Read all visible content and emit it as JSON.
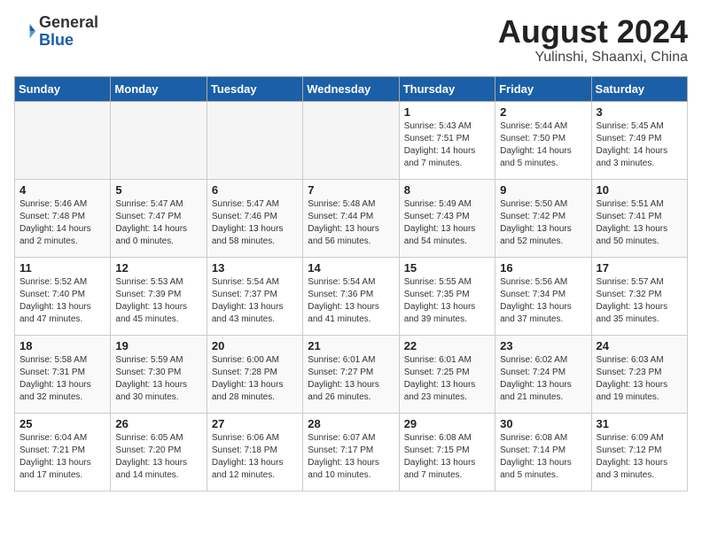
{
  "header": {
    "logo_general": "General",
    "logo_blue": "Blue",
    "month_year": "August 2024",
    "location": "Yulinshi, Shaanxi, China"
  },
  "weekdays": [
    "Sunday",
    "Monday",
    "Tuesday",
    "Wednesday",
    "Thursday",
    "Friday",
    "Saturday"
  ],
  "weeks": [
    [
      {
        "day": "",
        "info": ""
      },
      {
        "day": "",
        "info": ""
      },
      {
        "day": "",
        "info": ""
      },
      {
        "day": "",
        "info": ""
      },
      {
        "day": "1",
        "info": "Sunrise: 5:43 AM\nSunset: 7:51 PM\nDaylight: 14 hours\nand 7 minutes."
      },
      {
        "day": "2",
        "info": "Sunrise: 5:44 AM\nSunset: 7:50 PM\nDaylight: 14 hours\nand 5 minutes."
      },
      {
        "day": "3",
        "info": "Sunrise: 5:45 AM\nSunset: 7:49 PM\nDaylight: 14 hours\nand 3 minutes."
      }
    ],
    [
      {
        "day": "4",
        "info": "Sunrise: 5:46 AM\nSunset: 7:48 PM\nDaylight: 14 hours\nand 2 minutes."
      },
      {
        "day": "5",
        "info": "Sunrise: 5:47 AM\nSunset: 7:47 PM\nDaylight: 14 hours\nand 0 minutes."
      },
      {
        "day": "6",
        "info": "Sunrise: 5:47 AM\nSunset: 7:46 PM\nDaylight: 13 hours\nand 58 minutes."
      },
      {
        "day": "7",
        "info": "Sunrise: 5:48 AM\nSunset: 7:44 PM\nDaylight: 13 hours\nand 56 minutes."
      },
      {
        "day": "8",
        "info": "Sunrise: 5:49 AM\nSunset: 7:43 PM\nDaylight: 13 hours\nand 54 minutes."
      },
      {
        "day": "9",
        "info": "Sunrise: 5:50 AM\nSunset: 7:42 PM\nDaylight: 13 hours\nand 52 minutes."
      },
      {
        "day": "10",
        "info": "Sunrise: 5:51 AM\nSunset: 7:41 PM\nDaylight: 13 hours\nand 50 minutes."
      }
    ],
    [
      {
        "day": "11",
        "info": "Sunrise: 5:52 AM\nSunset: 7:40 PM\nDaylight: 13 hours\nand 47 minutes."
      },
      {
        "day": "12",
        "info": "Sunrise: 5:53 AM\nSunset: 7:39 PM\nDaylight: 13 hours\nand 45 minutes."
      },
      {
        "day": "13",
        "info": "Sunrise: 5:54 AM\nSunset: 7:37 PM\nDaylight: 13 hours\nand 43 minutes."
      },
      {
        "day": "14",
        "info": "Sunrise: 5:54 AM\nSunset: 7:36 PM\nDaylight: 13 hours\nand 41 minutes."
      },
      {
        "day": "15",
        "info": "Sunrise: 5:55 AM\nSunset: 7:35 PM\nDaylight: 13 hours\nand 39 minutes."
      },
      {
        "day": "16",
        "info": "Sunrise: 5:56 AM\nSunset: 7:34 PM\nDaylight: 13 hours\nand 37 minutes."
      },
      {
        "day": "17",
        "info": "Sunrise: 5:57 AM\nSunset: 7:32 PM\nDaylight: 13 hours\nand 35 minutes."
      }
    ],
    [
      {
        "day": "18",
        "info": "Sunrise: 5:58 AM\nSunset: 7:31 PM\nDaylight: 13 hours\nand 32 minutes."
      },
      {
        "day": "19",
        "info": "Sunrise: 5:59 AM\nSunset: 7:30 PM\nDaylight: 13 hours\nand 30 minutes."
      },
      {
        "day": "20",
        "info": "Sunrise: 6:00 AM\nSunset: 7:28 PM\nDaylight: 13 hours\nand 28 minutes."
      },
      {
        "day": "21",
        "info": "Sunrise: 6:01 AM\nSunset: 7:27 PM\nDaylight: 13 hours\nand 26 minutes."
      },
      {
        "day": "22",
        "info": "Sunrise: 6:01 AM\nSunset: 7:25 PM\nDaylight: 13 hours\nand 23 minutes."
      },
      {
        "day": "23",
        "info": "Sunrise: 6:02 AM\nSunset: 7:24 PM\nDaylight: 13 hours\nand 21 minutes."
      },
      {
        "day": "24",
        "info": "Sunrise: 6:03 AM\nSunset: 7:23 PM\nDaylight: 13 hours\nand 19 minutes."
      }
    ],
    [
      {
        "day": "25",
        "info": "Sunrise: 6:04 AM\nSunset: 7:21 PM\nDaylight: 13 hours\nand 17 minutes."
      },
      {
        "day": "26",
        "info": "Sunrise: 6:05 AM\nSunset: 7:20 PM\nDaylight: 13 hours\nand 14 minutes."
      },
      {
        "day": "27",
        "info": "Sunrise: 6:06 AM\nSunset: 7:18 PM\nDaylight: 13 hours\nand 12 minutes."
      },
      {
        "day": "28",
        "info": "Sunrise: 6:07 AM\nSunset: 7:17 PM\nDaylight: 13 hours\nand 10 minutes."
      },
      {
        "day": "29",
        "info": "Sunrise: 6:08 AM\nSunset: 7:15 PM\nDaylight: 13 hours\nand 7 minutes."
      },
      {
        "day": "30",
        "info": "Sunrise: 6:08 AM\nSunset: 7:14 PM\nDaylight: 13 hours\nand 5 minutes."
      },
      {
        "day": "31",
        "info": "Sunrise: 6:09 AM\nSunset: 7:12 PM\nDaylight: 13 hours\nand 3 minutes."
      }
    ]
  ]
}
